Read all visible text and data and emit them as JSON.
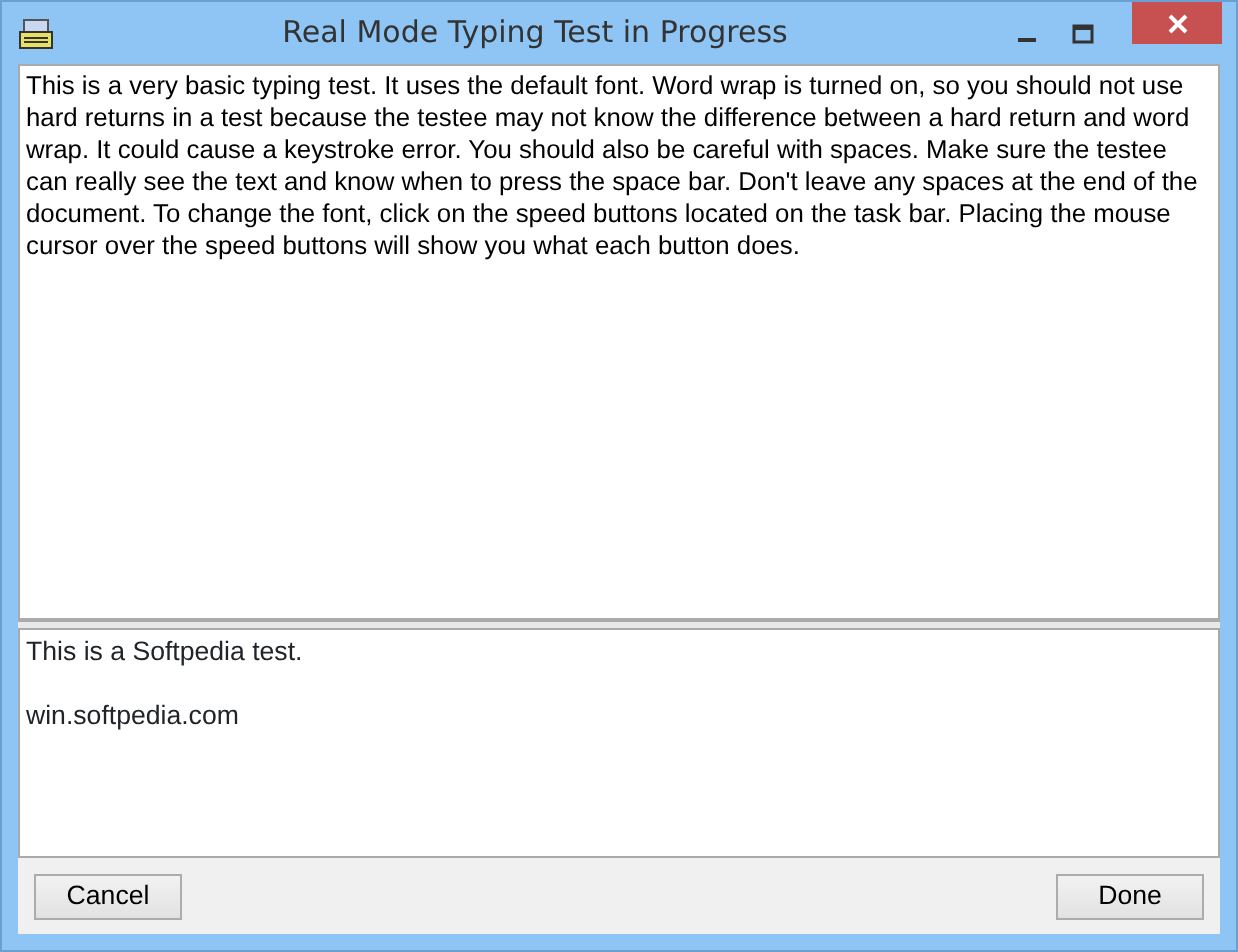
{
  "window": {
    "title": "Real Mode Typing Test in Progress"
  },
  "test_text": "This is a very basic typing test. It uses the default font. Word wrap is turned on, so you should not use hard returns in a test because the testee may not know the difference between a hard return and word wrap. It could cause a keystroke error. You should also be careful with spaces. Make sure the testee can really see the text and know when to press the space bar. Don't leave any spaces at the end of the document. To change the font, click on the speed buttons located on the task bar. Placing the mouse cursor over the speed buttons will show you what each button does.",
  "typed_paragraphs": [
    "This is a Softpedia test.",
    "win.softpedia.com"
  ],
  "buttons": [
    {
      "label": "Cancel"
    },
    {
      "label": "Done"
    }
  ]
}
